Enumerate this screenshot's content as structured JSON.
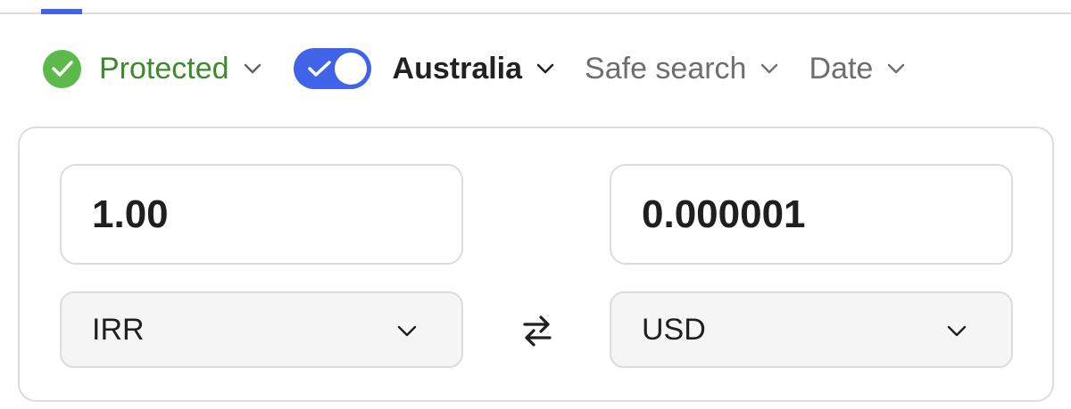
{
  "filters": {
    "protected": {
      "label": "Protected",
      "color": "#3c8a2c"
    },
    "region": {
      "label": "Australia",
      "toggle_on": true,
      "toggle_color": "#4063e8"
    },
    "safe_search": {
      "label": "Safe search"
    },
    "date": {
      "label": "Date"
    }
  },
  "converter": {
    "from_amount": "1.00",
    "to_amount": "0.000001",
    "from_currency": "IRR",
    "to_currency": "USD",
    "swap_icon": "swap-arrows-icon"
  }
}
